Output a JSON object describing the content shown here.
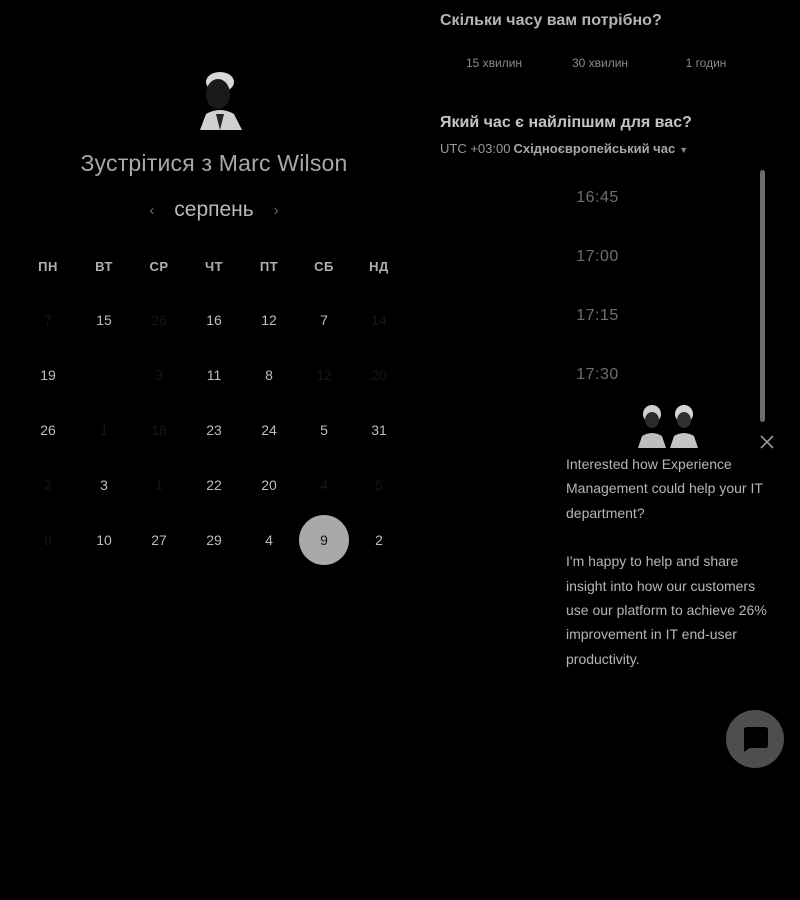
{
  "meeting": {
    "title": "Зустрітися з Marc Wilson",
    "month": "серпень"
  },
  "calendar": {
    "weekdays": [
      "ПН",
      "ВТ",
      "СР",
      "ЧТ",
      "ПТ",
      "СБ",
      "НД"
    ],
    "weeks": [
      [
        {
          "d": "7",
          "dim": true
        },
        {
          "d": "15"
        },
        {
          "d": "26",
          "dim": true
        },
        {
          "d": "16"
        },
        {
          "d": "12"
        },
        {
          "d": "7"
        },
        {
          "d": "14",
          "dim": true
        }
      ],
      [
        {
          "d": "19"
        },
        {
          "d": "",
          "dim": true
        },
        {
          "d": "3",
          "dim": true
        },
        {
          "d": "11"
        },
        {
          "d": "8"
        },
        {
          "d": "12",
          "dim": true
        },
        {
          "d": "20",
          "dim": true
        }
      ],
      [
        {
          "d": "26"
        },
        {
          "d": "1",
          "dim": true
        },
        {
          "d": "18",
          "dim": true
        },
        {
          "d": "23"
        },
        {
          "d": "24"
        },
        {
          "d": "5"
        },
        {
          "d": "31"
        }
      ],
      [
        {
          "d": "2",
          "dim": true
        },
        {
          "d": "3"
        },
        {
          "d": "1",
          "dim": true
        },
        {
          "d": "22"
        },
        {
          "d": "20"
        },
        {
          "d": "4",
          "dim": true
        },
        {
          "d": "5",
          "dim": true
        }
      ],
      [
        {
          "d": "9",
          "dim": true
        },
        {
          "d": "10"
        },
        {
          "d": "27"
        },
        {
          "d": "29"
        },
        {
          "d": "4"
        },
        {
          "d": "9",
          "selected": true
        },
        {
          "d": "2"
        }
      ]
    ]
  },
  "duration": {
    "question": "Скільки часу вам потрібно?",
    "options": [
      "15 хвилин",
      "30 хвилин",
      "1 годин"
    ]
  },
  "time": {
    "question": "Який час є найліпшим для вас?",
    "timezone_offset": "UTC +03:00",
    "timezone_name": "Східноєвропейський час",
    "slots": [
      "16:45",
      "17:00",
      "17:15",
      "17:30"
    ]
  },
  "chat": {
    "message_1": "Interested how Experience Management could help your IT department?",
    "message_2": "I'm happy to help and share insight into how our customers use our platform to achieve 26% improvement in IT end-user productivity."
  },
  "colors": {
    "background": "#000000",
    "selected_day": "#a8a8a8",
    "launcher": "#4e4e4e"
  }
}
